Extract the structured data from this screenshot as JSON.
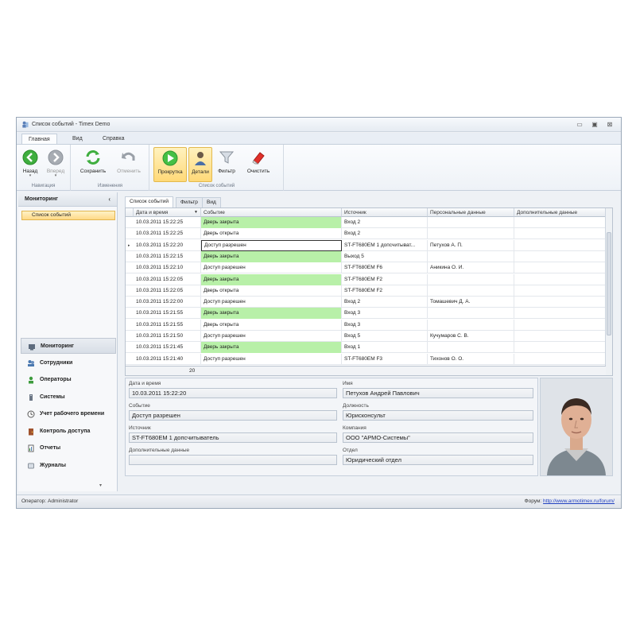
{
  "window": {
    "title": "Список событий - Timex Demo",
    "minimize": "▭",
    "restore": "▣",
    "close": "⊠"
  },
  "menu_tabs": [
    "Главная",
    "Вид",
    "Справка"
  ],
  "ribbon": {
    "groups": [
      "Навигация",
      "Изменения",
      "Список событий"
    ],
    "buttons": {
      "back": "Назад",
      "forward": "Вперед",
      "save": "Сохранить",
      "cancel": "Отменить",
      "scroll": "Прокрутка",
      "details": "Детали",
      "filter": "Фильтр",
      "clear": "Очистить"
    },
    "caret": "▾"
  },
  "sidebar": {
    "header": "Мониторинг",
    "collapse": "‹",
    "items": [
      "Список событий"
    ],
    "nav": [
      "Мониторинг",
      "Сотрудники",
      "Операторы",
      "Системы",
      "Учет рабочего времени",
      "Контроль доступа",
      "Отчеты",
      "Журналы"
    ],
    "more": "▾"
  },
  "content_tabs": [
    "Список событий",
    "Фильтр",
    "Вид"
  ],
  "grid": {
    "columns": [
      "Дата и время",
      "Событие",
      "Источник",
      "Персональные данные",
      "Дополнительные данные"
    ],
    "sort_glyph": "▼",
    "current_marker": "▸",
    "rows": [
      {
        "datetime": "10.03.2011 15:22:25",
        "event": "Дверь закрыта",
        "source": "Вход 2",
        "person": "",
        "extra": ""
      },
      {
        "datetime": "10.03.2011 15:22:25",
        "event": "Дверь открыта",
        "source": "Вход 2",
        "person": "",
        "extra": ""
      },
      {
        "datetime": "10.03.2011 15:22:20",
        "event": "Доступ разрешен",
        "source": "ST-FT680EM 1 допсчитыват...",
        "person": "Петухов А. П.",
        "extra": ""
      },
      {
        "datetime": "10.03.2011 15:22:15",
        "event": "Дверь закрыта",
        "source": "Выход 5",
        "person": "",
        "extra": ""
      },
      {
        "datetime": "10.03.2011 15:22:10",
        "event": "Доступ разрешен",
        "source": "ST-FT680EM F6",
        "person": "Аникина О. И.",
        "extra": ""
      },
      {
        "datetime": "10.03.2011 15:22:05",
        "event": "Дверь закрыта",
        "source": "ST-FT680EM F2",
        "person": "",
        "extra": ""
      },
      {
        "datetime": "10.03.2011 15:22:05",
        "event": "Дверь открыта",
        "source": "ST-FT680EM F2",
        "person": "",
        "extra": ""
      },
      {
        "datetime": "10.03.2011 15:22:00",
        "event": "Доступ разрешен",
        "source": "Вход 2",
        "person": "Томашевич Д. А.",
        "extra": ""
      },
      {
        "datetime": "10.03.2011 15:21:55",
        "event": "Дверь закрыта",
        "source": "Вход 3",
        "person": "",
        "extra": ""
      },
      {
        "datetime": "10.03.2011 15:21:55",
        "event": "Дверь открыта",
        "source": "Вход 3",
        "person": "",
        "extra": ""
      },
      {
        "datetime": "10.03.2011 15:21:50",
        "event": "Доступ разрешен",
        "source": "Вход 5",
        "person": "Кучумаров С. В.",
        "extra": ""
      },
      {
        "datetime": "10.03.2011 15:21:45",
        "event": "Дверь закрыта",
        "source": "Вход 1",
        "person": "",
        "extra": ""
      },
      {
        "datetime": "10.03.2011 15:21:40",
        "event": "Доступ разрешен",
        "source": "ST-FT680EM F3",
        "person": "Тихонов О. О.",
        "extra": ""
      }
    ],
    "count": "20"
  },
  "details": {
    "labels": {
      "datetime": "Дата и время",
      "event": "Событие",
      "source": "Источник",
      "extra": "Дополнительные данные",
      "name": "Имя",
      "position": "Должность",
      "company": "Компания",
      "department": "Отдел"
    },
    "values": {
      "datetime": "10.03.2011 15:22:20",
      "event": "Доступ разрешен",
      "source": "ST-FT680EM 1 допсчитыватель",
      "extra": "",
      "name": "Петухов Андрей Павлович",
      "position": "Юрисконсульт",
      "company": "ООО \"АРМО-Системы\"",
      "department": "Юридический отдел"
    }
  },
  "status": {
    "operator": "Оператор: Administrator",
    "forum_label": "Форум:",
    "forum_link": "http://www.armotimex.ru/forum/"
  },
  "colors": {
    "event_closed": "#b8f0a8",
    "highlight": "#ffd978",
    "link": "#2040c0"
  }
}
